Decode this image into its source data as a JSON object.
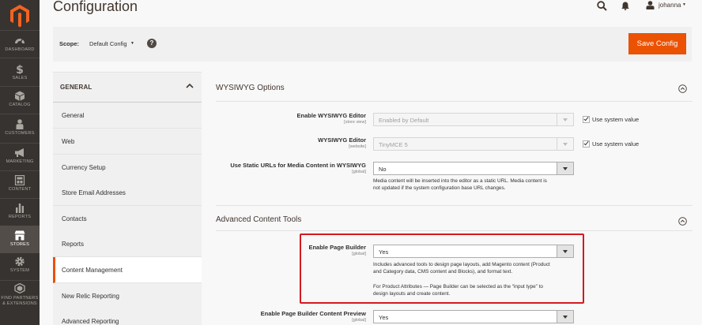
{
  "sidebar": {
    "items": [
      {
        "label": "DASHBOARD",
        "icon": "dashboard-icon"
      },
      {
        "label": "SALES",
        "icon": "dollar-icon"
      },
      {
        "label": "CATALOG",
        "icon": "cube-icon"
      },
      {
        "label": "CUSTOMERS",
        "icon": "person-icon"
      },
      {
        "label": "MARKETING",
        "icon": "megaphone-icon"
      },
      {
        "label": "CONTENT",
        "icon": "layout-icon"
      },
      {
        "label": "REPORTS",
        "icon": "bar-chart-icon"
      },
      {
        "label": "STORES",
        "icon": "store-icon"
      },
      {
        "label": "SYSTEM",
        "icon": "gear-icon"
      },
      {
        "label": "FIND PARTNERS",
        "label2": "& EXTENSIONS",
        "icon": "puzzle-icon"
      }
    ],
    "active": "STORES",
    "colors": {
      "background": "#373330",
      "active": "#524d49",
      "accent": "#eb5202"
    }
  },
  "header": {
    "title": "Configuration",
    "user": "johanna",
    "icons": [
      "search-icon",
      "bell-icon",
      "user-icon"
    ]
  },
  "scope": {
    "label": "Scope:",
    "value": "Default Config",
    "help": "?"
  },
  "actions": {
    "save_label": "Save Config"
  },
  "tabs": {
    "title": "GENERAL",
    "items": [
      "General",
      "Web",
      "Currency Setup",
      "Store Email Addresses",
      "Contacts",
      "Reports",
      "Content Management",
      "New Relic Reporting",
      "Advanced Reporting"
    ],
    "active": "Content Management"
  },
  "sections": {
    "wysiwyg": {
      "title": "WYSIWYG Options",
      "fields": {
        "enable_editor": {
          "label": "Enable WYSIWYG Editor",
          "scope": "[store view]",
          "value": "Enabled by Default",
          "disabled": true,
          "use_system": "Use system value"
        },
        "editor": {
          "label": "WYSIWYG Editor",
          "scope": "[website]",
          "value": "TinyMCE 5",
          "disabled": true,
          "use_system": "Use system value"
        },
        "static_urls": {
          "label": "Use Static URLs for Media Content in WYSIWYG",
          "scope": "[global]",
          "value": "No",
          "note_lines": [
            "Media content will be inserted into the editor as a static URL. Media content is",
            "not updated if the system configuration base URL changes."
          ]
        }
      }
    },
    "advanced": {
      "title": "Advanced Content Tools",
      "fields": {
        "page_builder": {
          "label": "Enable Page Builder",
          "scope": "[global]",
          "value": "Yes",
          "note_lines": [
            "Includes advanced tools to design page layouts, add Magento content (Product",
            "and Category data, CMS content and Blocks), and format text."
          ],
          "note2_lines": [
            "For Product Attributes — Page Builder can be selected as the “input type” to",
            "design layouts and create content."
          ]
        },
        "preview": {
          "label": "Enable Page Builder Content Preview",
          "scope": "[global]",
          "value": "Yes"
        }
      }
    }
  }
}
